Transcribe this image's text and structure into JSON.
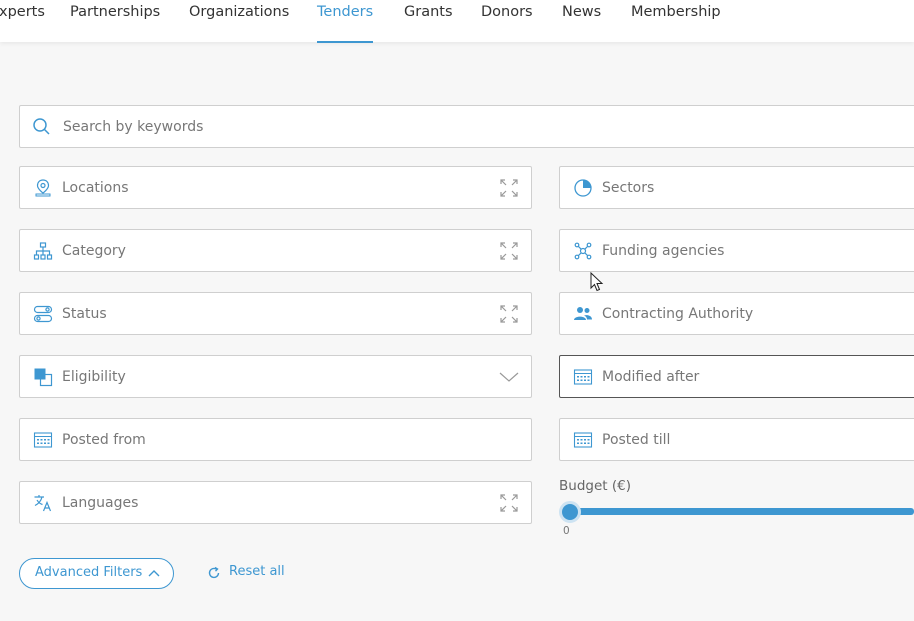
{
  "nav": {
    "items": [
      {
        "label": "xperts"
      },
      {
        "label": "Partnerships"
      },
      {
        "label": "Organizations"
      },
      {
        "label": "Tenders"
      },
      {
        "label": "Grants"
      },
      {
        "label": "Donors"
      },
      {
        "label": "News"
      },
      {
        "label": "Membership"
      }
    ],
    "active": "Tenders"
  },
  "search": {
    "placeholder": "Search by keywords"
  },
  "filters": {
    "locations": "Locations",
    "sectors": "Sectors",
    "category": "Category",
    "funding_agencies": "Funding agencies",
    "status": "Status",
    "contracting_authority": "Contracting Authority",
    "eligibility": "Eligibility",
    "modified_after": "Modified after",
    "posted_from": "Posted from",
    "posted_till": "Posted till",
    "languages": "Languages"
  },
  "budget": {
    "label": "Budget (€)",
    "min_label": "0",
    "value": 0
  },
  "actions": {
    "advanced_filters": "Advanced Filters",
    "reset_all": "Reset all"
  },
  "colors": {
    "accent": "#3e97d1",
    "border": "#cfcfcf",
    "background": "#f7f7f7"
  },
  "icons": {
    "search": "search-icon",
    "locations": "map-pin-icon",
    "sectors": "pie-chart-icon",
    "category": "hierarchy-icon",
    "funding": "network-icon",
    "status": "toggles-icon",
    "contracting": "people-icon",
    "eligibility": "overlap-squares-icon",
    "calendar": "calendar-icon",
    "languages": "translate-icon",
    "expand": "expand-icon",
    "chevron": "chevron-down-icon",
    "reset": "refresh-icon"
  }
}
